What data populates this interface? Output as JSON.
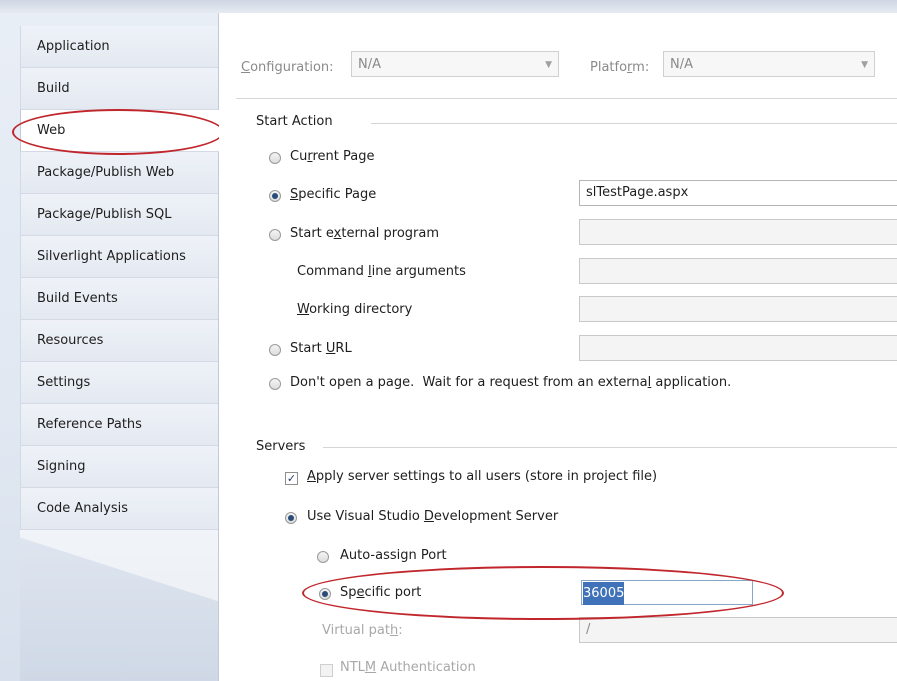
{
  "sidebar": {
    "items": [
      {
        "label": "Application",
        "selected": false
      },
      {
        "label": "Build",
        "selected": false
      },
      {
        "label": "Web",
        "selected": true
      },
      {
        "label": "Package/Publish Web",
        "selected": false
      },
      {
        "label": "Package/Publish SQL",
        "selected": false
      },
      {
        "label": "Silverlight Applications",
        "selected": false
      },
      {
        "label": "Build Events",
        "selected": false
      },
      {
        "label": "Resources",
        "selected": false
      },
      {
        "label": "Settings",
        "selected": false
      },
      {
        "label": "Reference Paths",
        "selected": false
      },
      {
        "label": "Signing",
        "selected": false
      },
      {
        "label": "Code Analysis",
        "selected": false
      }
    ]
  },
  "config": {
    "configuration_label": "Configuration:",
    "configuration_value": "N/A",
    "platform_label": "Platform:",
    "platform_value": "N/A"
  },
  "start_action": {
    "title": "Start Action",
    "current_page": "Current Page",
    "specific_page": "Specific Page",
    "specific_page_value": "slTestPage.aspx",
    "start_external_program": "Start external program",
    "command_line_arguments": "Command line arguments",
    "working_directory": "Working directory",
    "start_url": "Start URL",
    "dont_open": "Don't open a page.  Wait for a request from an external application.",
    "selected": "specific_page"
  },
  "servers": {
    "title": "Servers",
    "apply_all_users": "Apply server settings to all users (store in project file)",
    "apply_all_users_checked": true,
    "use_vs_dev_server": "Use Visual Studio Development Server",
    "auto_assign_port": "Auto-assign Port",
    "specific_port": "Specific port",
    "specific_port_value": "36005",
    "virtual_path_label": "Virtual path:",
    "virtual_path_value": "/",
    "ntlm_auth": "NTLM Authentication"
  },
  "colors": {
    "annotation_red": "#c0262b",
    "selection_blue": "#3f72b8"
  }
}
